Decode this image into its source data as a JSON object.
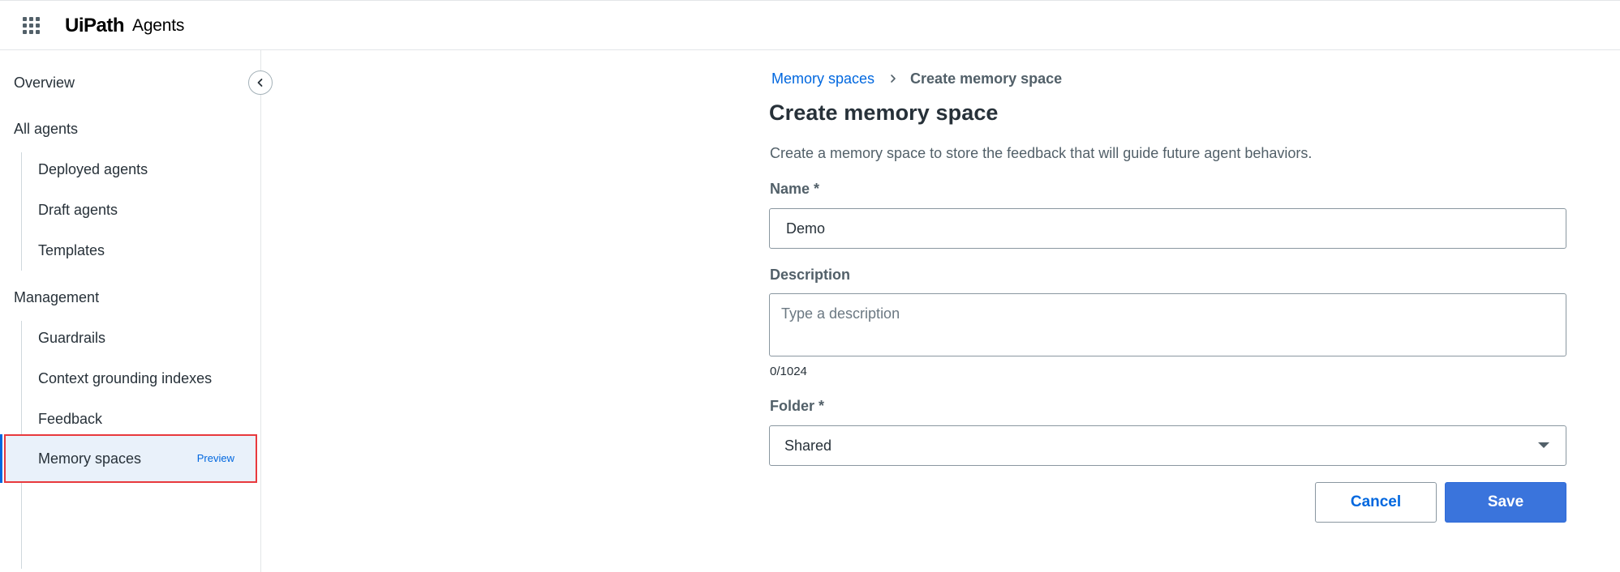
{
  "header": {
    "brand": "UiPath",
    "product": "Agents"
  },
  "sidebar": {
    "items": [
      {
        "label": "Overview"
      },
      {
        "label": "All agents"
      },
      {
        "label": "Deployed agents"
      },
      {
        "label": "Draft agents"
      },
      {
        "label": "Templates"
      },
      {
        "label": "Management"
      },
      {
        "label": "Guardrails"
      },
      {
        "label": "Context grounding indexes"
      },
      {
        "label": "Feedback"
      },
      {
        "label": "Memory spaces",
        "badge": "Preview",
        "active": true
      }
    ]
  },
  "breadcrumb": {
    "parent": "Memory spaces",
    "current": "Create memory space"
  },
  "form": {
    "title": "Create memory space",
    "description": "Create a memory space to store the feedback that will guide future agent behaviors.",
    "name_label": "Name *",
    "name_value": "Demo",
    "description_label": "Description",
    "description_placeholder": "Type a description",
    "char_count": "0/1024",
    "folder_label": "Folder *",
    "folder_value": "Shared",
    "cancel_label": "Cancel",
    "save_label": "Save"
  },
  "colors": {
    "accent": "#0067df",
    "primary_button": "#3a74dc",
    "highlight_border": "#e8393d",
    "active_bg": "#e9f1fa"
  }
}
